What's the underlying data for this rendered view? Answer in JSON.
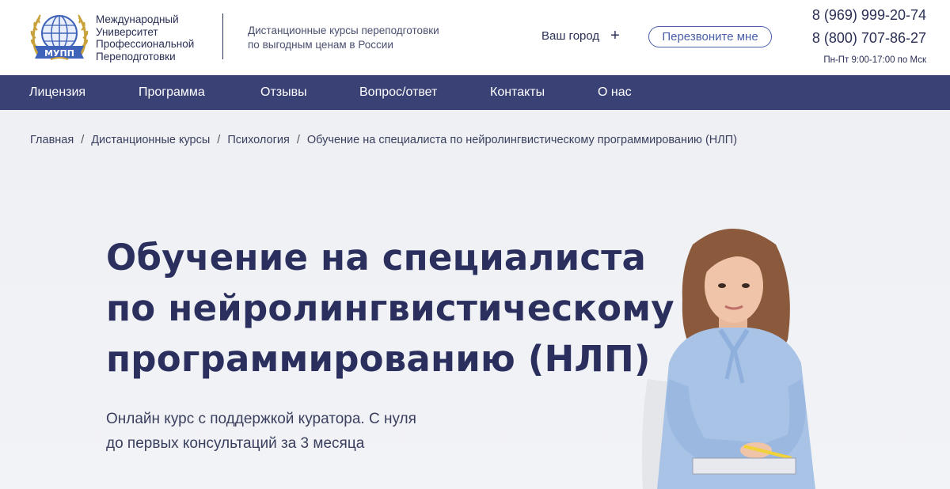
{
  "header": {
    "logo": {
      "emblem_text": "МУПП",
      "name_lines": [
        "Международный",
        "Университет",
        "Профессиональной",
        "Переподготовки"
      ]
    },
    "tagline_lines": [
      "Дистанционные курсы переподготовки",
      "по выгодным ценам в России"
    ],
    "city_label": "Ваш город",
    "callback_label": "Перезвоните мне",
    "phones": [
      "8 (969) 999-20-74",
      "8 (800) 707-86-27"
    ],
    "hours": "Пн-Пт 9:00-17:00 по Мск"
  },
  "nav": {
    "items": [
      "Лицензия",
      "Программа",
      "Отзывы",
      "Вопрос/ответ",
      "Контакты",
      "О нас"
    ]
  },
  "breadcrumb": {
    "items": [
      "Главная",
      "Дистанционные курсы",
      "Психология",
      "Обучение на специалиста по нейролингвистическому программированию (НЛП)"
    ],
    "separator": "/"
  },
  "hero": {
    "title_lines": [
      "Обучение на специалиста",
      "по нейролингвистическому",
      "программированию (НЛП)"
    ],
    "subtitle_lines": [
      "Онлайн курс с поддержкой куратора. С нуля",
      "до первых консультаций за 3 месяца"
    ]
  },
  "colors": {
    "brand_navy": "#2a2f5e",
    "nav_bg": "#3a4175",
    "accent_blue": "#4a5fa8",
    "hero_bg": "#eef0f4"
  }
}
